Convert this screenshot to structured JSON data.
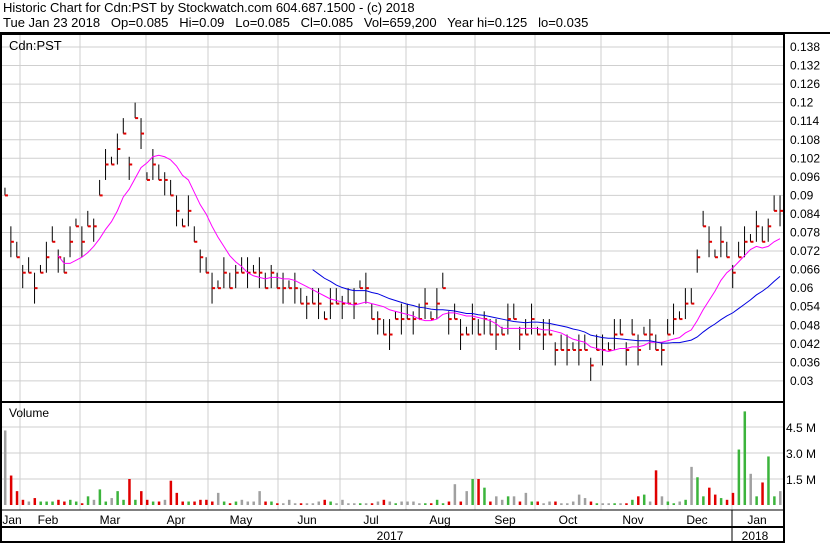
{
  "header": {
    "line1": "Historic Chart for Cdn:PST by Stockwatch.com 604.687.1500 - (c) 2018",
    "line2": "Tue Jan 23 2018   Op=0.085   Hi=0.09   Lo=0.085   Cl=0.085   Vol=659,200   Year hi=0.125   lo=0.035"
  },
  "chart_data": [
    {
      "type": "ohlc",
      "title": "Cdn:PST",
      "ylim": [
        0.024,
        0.144
      ],
      "yticks": [
        "0.138",
        "0.132",
        "0.126",
        "0.12",
        "0.114",
        "0.108",
        "0.102",
        "0.096",
        "0.09",
        "0.084",
        "0.078",
        "0.072",
        "0.066",
        "0.06",
        "0.054",
        "0.048",
        "0.042",
        "0.036",
        "0.03"
      ],
      "typical_range": 0.01,
      "closes": [
        0.09,
        0.075,
        0.07,
        0.065,
        0.065,
        0.06,
        0.065,
        0.07,
        0.075,
        0.07,
        0.065,
        0.075,
        0.08,
        0.075,
        0.08,
        0.08,
        0.09,
        0.1,
        0.1,
        0.105,
        0.11,
        0.1,
        0.115,
        0.11,
        0.095,
        0.1,
        0.095,
        0.095,
        0.09,
        0.085,
        0.08,
        0.085,
        0.075,
        0.07,
        0.065,
        0.06,
        0.06,
        0.065,
        0.06,
        0.065,
        0.065,
        0.065,
        0.065,
        0.065,
        0.06,
        0.065,
        0.06,
        0.06,
        0.06,
        0.06,
        0.055,
        0.055,
        0.055,
        0.055,
        0.05,
        0.055,
        0.055,
        0.055,
        0.055,
        0.055,
        0.06,
        0.06,
        0.05,
        0.05,
        0.045,
        0.045,
        0.05,
        0.05,
        0.05,
        0.05,
        0.05,
        0.055,
        0.05,
        0.055,
        0.06,
        0.05,
        0.05,
        0.045,
        0.045,
        0.05,
        0.045,
        0.05,
        0.045,
        0.045,
        0.045,
        0.05,
        0.05,
        0.045,
        0.045,
        0.05,
        0.045,
        0.045,
        0.045,
        0.04,
        0.04,
        0.04,
        0.04,
        0.04,
        0.04,
        0.035,
        0.04,
        0.04,
        0.04,
        0.045,
        0.045,
        0.04,
        0.045,
        0.04,
        0.045,
        0.045,
        0.04,
        0.04,
        0.045,
        0.05,
        0.05,
        0.055,
        0.055,
        0.07,
        0.08,
        0.075,
        0.07,
        0.075,
        0.07,
        0.065,
        0.07,
        0.075,
        0.075,
        0.08,
        0.075,
        0.08,
        0.085,
        0.085
      ],
      "ma_short_window": 10,
      "ma_long_window": 25,
      "ma_long_start": 52,
      "colors": {
        "bar": "#000000",
        "close_tick": "#e00000",
        "ma_short": "#ff00ff",
        "ma_long": "#0000e0"
      }
    },
    {
      "type": "bar",
      "title": "Volume",
      "ylim": [
        0,
        6.2
      ],
      "unit": "M",
      "yticks": [
        "4.5 M",
        "3.0 M",
        "1.5 M"
      ],
      "ytick_values": [
        4.5,
        3.0,
        1.5
      ],
      "values": [
        4.3,
        1.7,
        0.8,
        0.3,
        0.2,
        0.4,
        0.2,
        0.2,
        0.2,
        0.3,
        0.2,
        0.3,
        0.2,
        0.1,
        0.5,
        0.3,
        0.9,
        0.2,
        0.4,
        0.8,
        0.3,
        1.5,
        0.3,
        0.8,
        0.3,
        0.2,
        0.2,
        0.3,
        1.4,
        0.7,
        0.2,
        0.2,
        0.2,
        0.3,
        0.3,
        0.2,
        0.7,
        0.2,
        0.1,
        0.2,
        0.3,
        0.2,
        0.2,
        0.8,
        0.2,
        0.2,
        0.1,
        0.1,
        0.3,
        0.1,
        0.1,
        0.1,
        0.1,
        0.2,
        0.3,
        0.2,
        0.1,
        0.3,
        0.1,
        0.1,
        0.1,
        0.1,
        0.1,
        0.2,
        0.3,
        0.2,
        0.1,
        0.2,
        0.2,
        0.2,
        0.1,
        0.1,
        0.1,
        0.3,
        0.1,
        0.2,
        1.2,
        0.2,
        0.8,
        1.5,
        1.5,
        1.0,
        0.2,
        0.5,
        0.3,
        0.5,
        0.5,
        0.2,
        0.7,
        0.2,
        0.2,
        0.1,
        0.2,
        0.2,
        0.1,
        0.1,
        0.2,
        0.6,
        0.4,
        0.2,
        0.1,
        0.1,
        0.1,
        0.1,
        0.1,
        0.1,
        0.3,
        0.5,
        0.6,
        0.2,
        2.0,
        0.5,
        0.2,
        0.1,
        0.2,
        0.3,
        2.2,
        1.6,
        0.5,
        1.0,
        0.6,
        0.4,
        0.3,
        0.7,
        3.2,
        5.4,
        1.8,
        0.5,
        1.3,
        2.8,
        0.5,
        0.8
      ],
      "colors": {
        "up": "#3cb43c",
        "down": "#e00000",
        "flat": "#a0a0a0"
      }
    },
    {
      "type": "axis",
      "months": [
        "Jan",
        "Feb",
        "Mar",
        "Apr",
        "May",
        "Jun",
        "Jul",
        "Aug",
        "Sep",
        "Oct",
        "Nov",
        "Dec",
        "Jan"
      ],
      "years": [
        "2017",
        "2018"
      ]
    }
  ]
}
